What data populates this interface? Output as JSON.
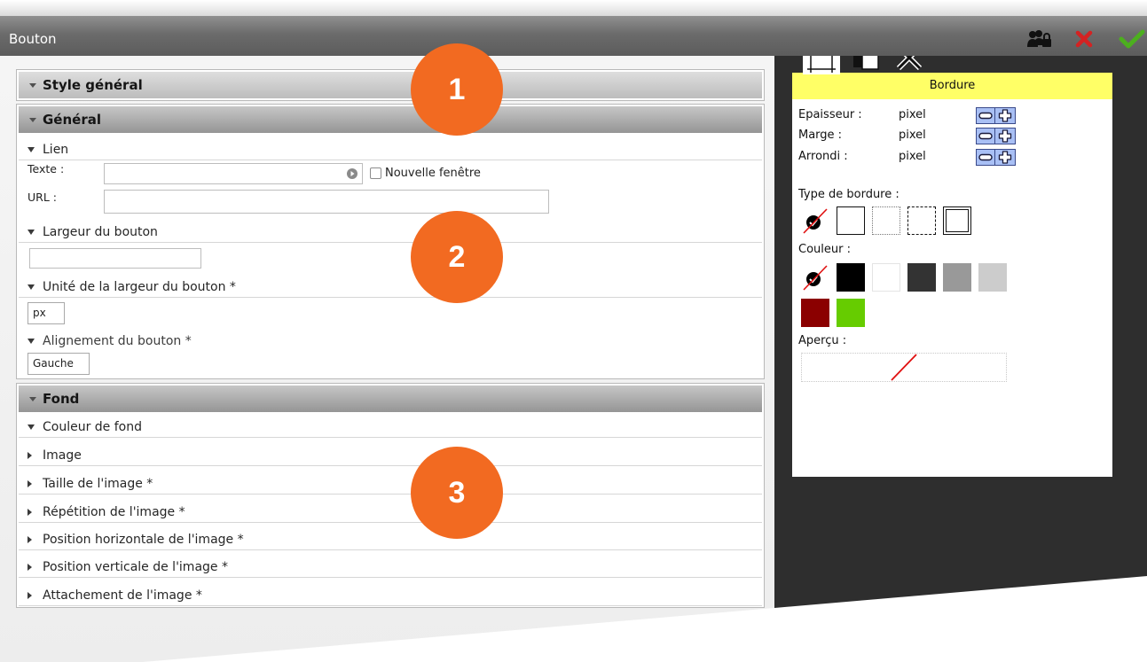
{
  "window": {
    "title": "Bouton"
  },
  "title_actions": {
    "permissions": {
      "icon": "users-lock-icon"
    },
    "close": {
      "icon": "close-icon",
      "color": "#d42222"
    },
    "validate": {
      "icon": "check-icon",
      "color": "#4caf1e"
    }
  },
  "sections": {
    "style_general": {
      "title": "Style général"
    },
    "general": {
      "title": "Général",
      "lien": {
        "label": "Lien",
        "expanded": true,
        "texte_label": "Texte :",
        "texte_value": "",
        "nouvelle_fenetre_label": "Nouvelle fenêtre",
        "nouvelle_fenetre_checked": false,
        "url_label": "URL :",
        "url_value": ""
      },
      "largeur": {
        "label": "Largeur du bouton",
        "expanded": true,
        "value": ""
      },
      "unite": {
        "label": "Unité de la largeur du bouton *",
        "expanded": true,
        "value": "px"
      },
      "alignement": {
        "label": "Alignement du bouton *",
        "expanded": true,
        "value": "Gauche"
      }
    },
    "fond": {
      "title": "Fond",
      "items": [
        {
          "label": "Couleur de fond",
          "expanded": true
        },
        {
          "label": "Image",
          "expanded": false
        },
        {
          "label": "Taille de l'image *",
          "expanded": false
        },
        {
          "label": "Répétition de l'image *",
          "expanded": false
        },
        {
          "label": "Position horizontale de l'image *",
          "expanded": false
        },
        {
          "label": "Position verticale de l'image *",
          "expanded": false
        },
        {
          "label": "Attachement de l'image *",
          "expanded": false
        }
      ]
    }
  },
  "callouts": {
    "color": "#f26a21",
    "labels": [
      "1",
      "2",
      "3"
    ]
  },
  "border_panel": {
    "tab_icons": [
      "border-frame-icon",
      "copy-style-icon",
      "tools-icon"
    ],
    "title": "Bordure",
    "header_color": "#ffff66",
    "properties": [
      {
        "label": "Epaisseur :",
        "unit": "pixel"
      },
      {
        "label": "Marge :",
        "unit": "pixel"
      },
      {
        "label": "Arrondi :",
        "unit": "pixel"
      }
    ],
    "border_type_label": "Type de bordure :",
    "border_types": [
      "none",
      "solid",
      "dotted",
      "dashed",
      "double"
    ],
    "color_label": "Couleur :",
    "colors": [
      "none",
      "#000000",
      "#ffffff",
      "#333333",
      "#999999",
      "#cccccc",
      "#8b0000",
      "#66cc00"
    ],
    "preview_label": "Aperçu :"
  }
}
